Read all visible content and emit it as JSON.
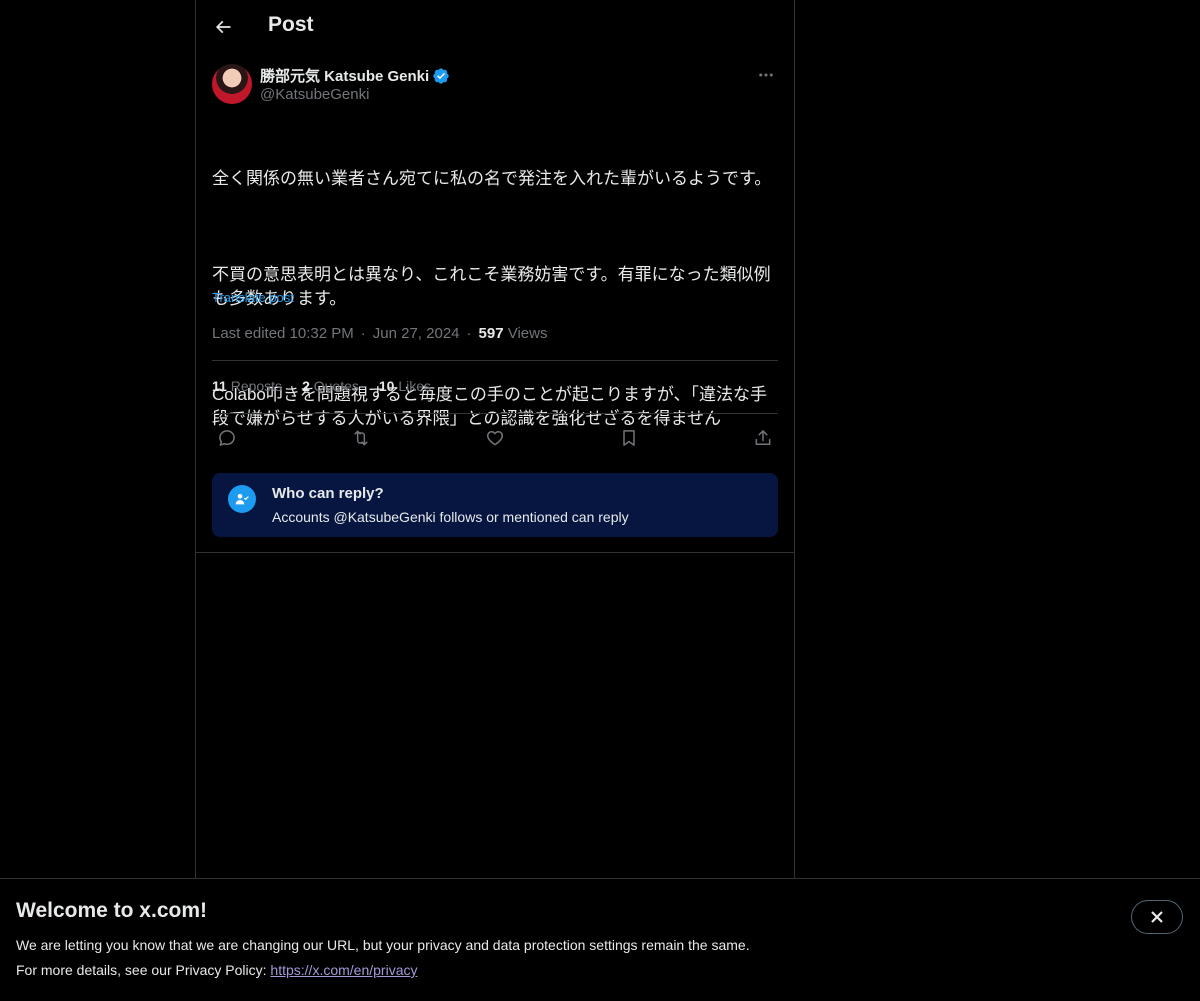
{
  "header": {
    "title": "Post"
  },
  "author": {
    "display_name": "勝部元気 Katsube Genki",
    "handle": "@KatsubeGenki",
    "verified_color": "#1d9bf0"
  },
  "post": {
    "paragraphs": [
      "全く関係の無い業者さん宛てに私の名で発注を入れた輩がいるようです。",
      "不買の意思表明とは異なり、これこそ業務妨害です。有罪になった類似例\nも多数あります。",
      "Colabo叩きを問題視すると毎度この手のことが起こりますが、「違法な手\n段で嫌がらせする人がいる界隈」との認識を強化せざるを得ません"
    ],
    "translate_label": "Translate post",
    "edited_label": "Last edited 10:32 PM",
    "date": "Jun 27, 2024",
    "separator": "·",
    "views_count": "597",
    "views_label": "Views"
  },
  "stats": [
    {
      "count": "11",
      "label": "Reposts"
    },
    {
      "count": "2",
      "label": "Quotes"
    },
    {
      "count": "10",
      "label": "Likes"
    }
  ],
  "actions": [
    "reply-icon",
    "repost-icon",
    "like-icon",
    "bookmark-icon",
    "share-icon"
  ],
  "reply_restriction": {
    "title": "Who can reply?",
    "subtitle": "Accounts @KatsubeGenki follows or mentioned can reply"
  },
  "banner": {
    "title": "Welcome to x.com!",
    "line1": "We are letting you know that we are changing our URL, but your privacy and data protection settings remain the same.",
    "line2_prefix": "For more details, see our Privacy Policy: ",
    "link_text": "https://x.com/en/privacy"
  }
}
